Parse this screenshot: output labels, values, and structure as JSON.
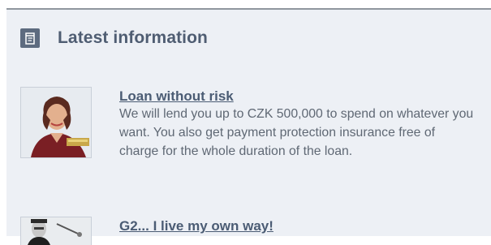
{
  "header": {
    "icon": "news-icon",
    "title": "Latest information"
  },
  "items": [
    {
      "title": "Loan without risk",
      "description": "We will lend you up to CZK 500,000 to spend on whatever you want. You also get payment protection insurance free of charge for the whole duration of the loan.",
      "thumbnail": "woman-portrait-photo"
    },
    {
      "title": "G2... I live my own way!",
      "thumbnail": "man-photo"
    }
  ],
  "colors": {
    "panel_background": "#edf0f5",
    "title": "#4f5d72",
    "link": "#4b5c74",
    "body_text": "#5f6874",
    "icon_background": "#5d6b7f"
  }
}
